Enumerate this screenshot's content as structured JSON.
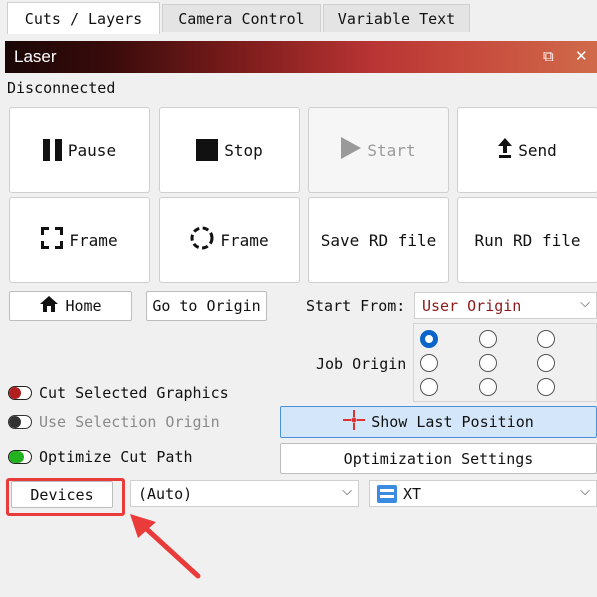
{
  "tabs": [
    {
      "label": "Cuts / Layers",
      "active": true
    },
    {
      "label": "Camera Control",
      "active": false
    },
    {
      "label": "Variable Text",
      "active": false
    }
  ],
  "panel": {
    "title": "Laser",
    "float_icon": "restore-window-icon",
    "close_icon": "close-icon"
  },
  "status": "Disconnected",
  "buttons": {
    "pause": "Pause",
    "stop": "Stop",
    "start": "Start",
    "send": "Send",
    "frame_rect": "Frame",
    "frame_circle": "Frame",
    "save_rd": "Save RD file",
    "run_rd": "Run RD file",
    "home": "Home",
    "go_origin": "Go to Origin",
    "show_last": "Show Last Position",
    "opt_settings": "Optimization Settings",
    "devices": "Devices"
  },
  "start_from": {
    "label": "Start From:",
    "value": "User Origin"
  },
  "job_origin": {
    "label": "Job Origin",
    "selected_row": 0,
    "selected_col": 0
  },
  "options": {
    "cut_selected": {
      "label": "Cut Selected Graphics",
      "state": "off"
    },
    "use_selection_origin": {
      "label": "Use Selection Origin",
      "state": "disabled"
    },
    "optimize_cut_path": {
      "label": "Optimize Cut Path",
      "state": "on"
    }
  },
  "device_port": {
    "value": "(Auto)"
  },
  "device_model": {
    "value": "XT",
    "icon": "controller-icon"
  },
  "colors": {
    "accent": "#0a64c9",
    "toggle_on": "#22b21e",
    "toggle_off_red": "#b11f1f",
    "annotation": "#ea3b3b"
  }
}
